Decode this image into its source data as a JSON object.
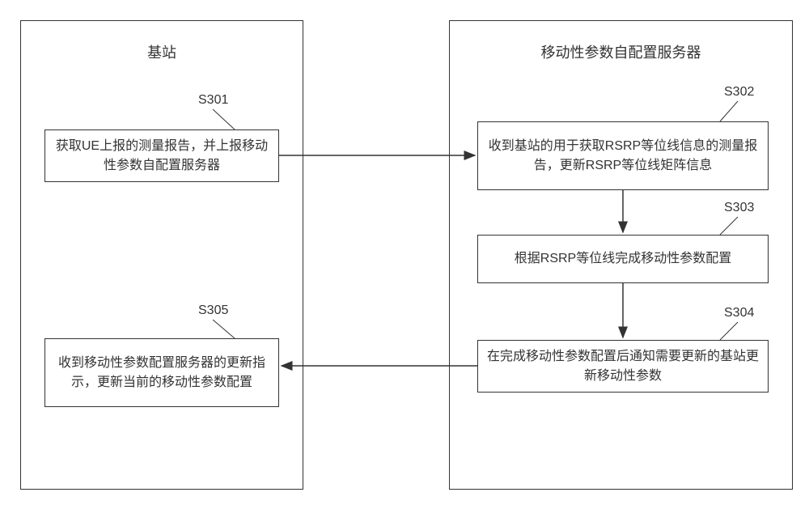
{
  "columns": {
    "left": {
      "title": "基站"
    },
    "right": {
      "title": "移动性参数自配置服务器"
    }
  },
  "steps": {
    "s301": {
      "label": "S301",
      "text": "获取UE上报的测量报告，并上报移动性参数自配置服务器"
    },
    "s302": {
      "label": "S302",
      "text": "收到基站的用于获取RSRP等位线信息的测量报告，更新RSRP等位线矩阵信息"
    },
    "s303": {
      "label": "S303",
      "text": "根据RSRP等位线完成移动性参数配置"
    },
    "s304": {
      "label": "S304",
      "text": "在完成移动性参数配置后通知需要更新的基站更新移动性参数"
    },
    "s305": {
      "label": "S305",
      "text": "收到移动性参数配置服务器的更新指示，更新当前的移动性参数配置"
    }
  }
}
